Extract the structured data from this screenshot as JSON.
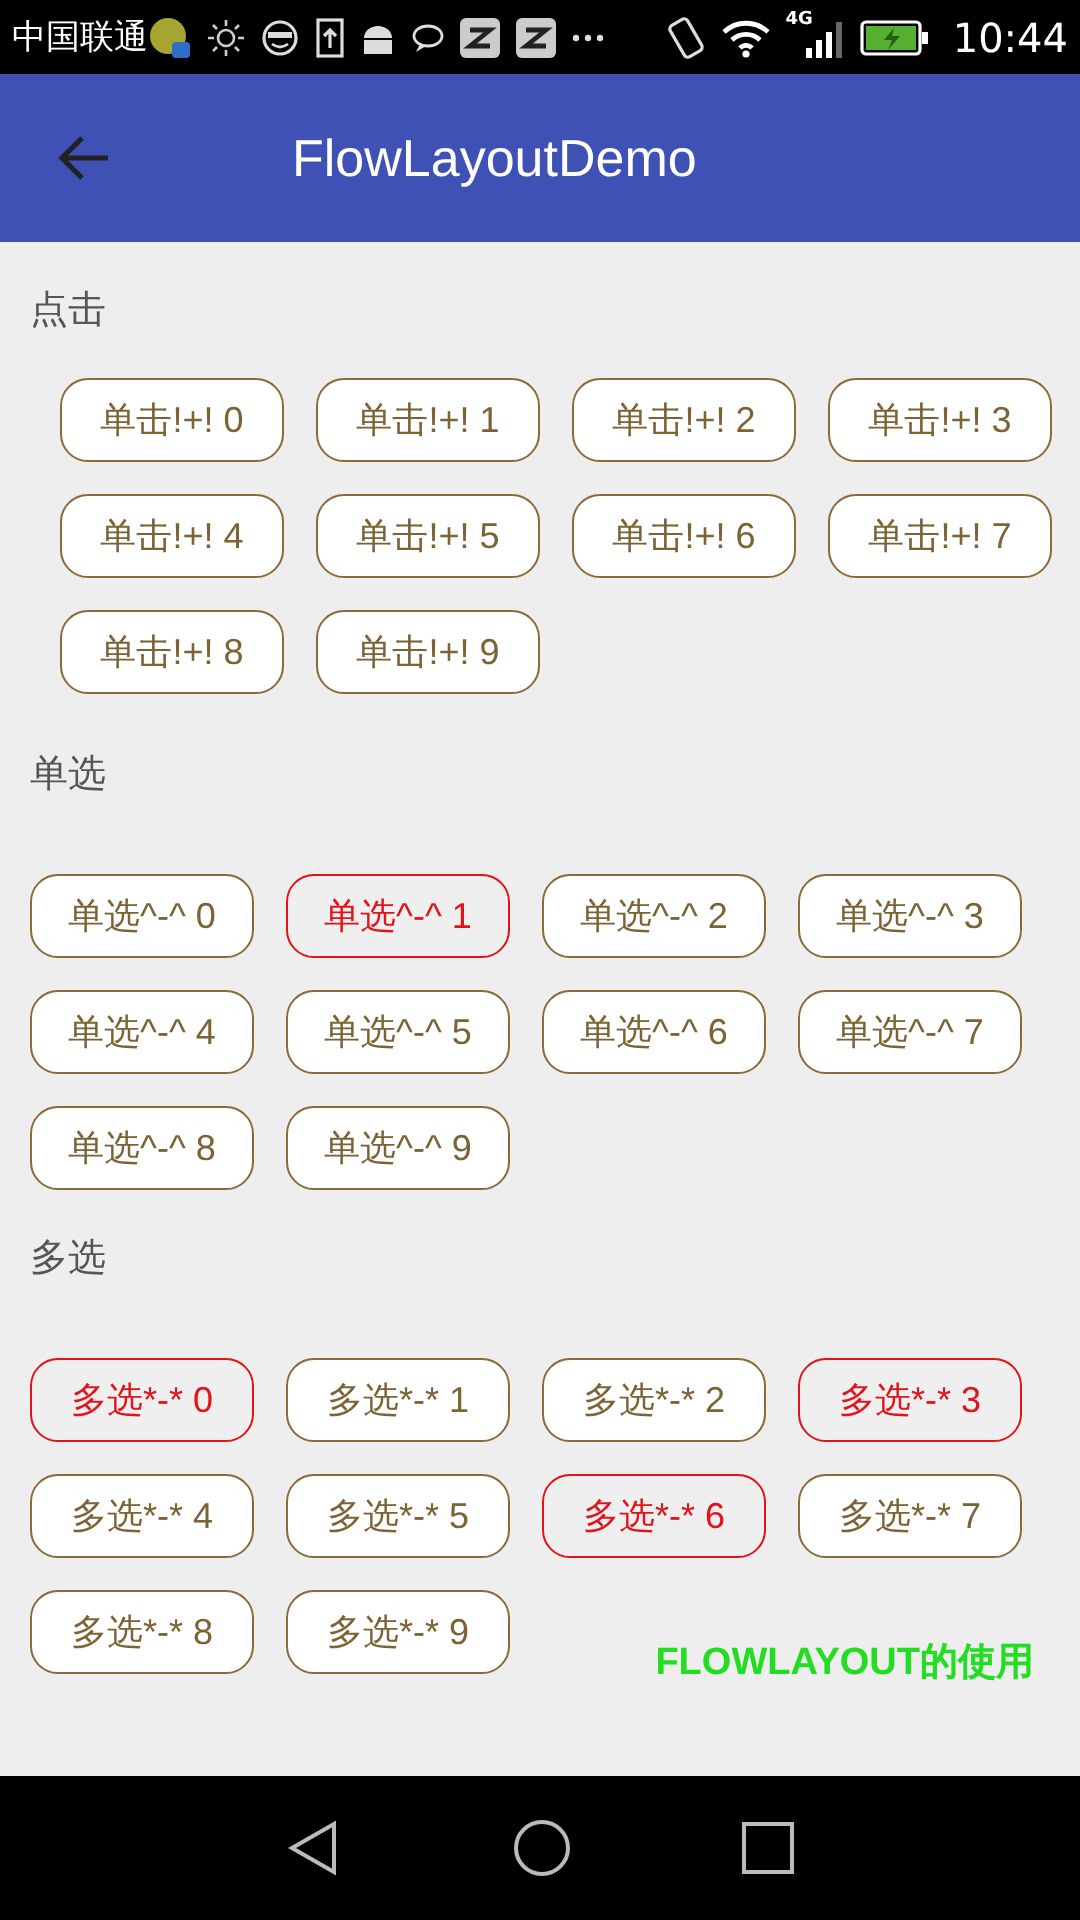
{
  "status_bar": {
    "carrier": "中国联通",
    "network": "4G",
    "time": "10:44"
  },
  "app_bar": {
    "title": "FlowLayoutDemo"
  },
  "sections": [
    {
      "kind": "click",
      "title": "点击",
      "tags": [
        {
          "label": "单击!+! 0",
          "selected": false
        },
        {
          "label": "单击!+! 1",
          "selected": false
        },
        {
          "label": "单击!+! 2",
          "selected": false
        },
        {
          "label": "单击!+! 3",
          "selected": false
        },
        {
          "label": "单击!+! 4",
          "selected": false
        },
        {
          "label": "单击!+! 5",
          "selected": false
        },
        {
          "label": "单击!+! 6",
          "selected": false
        },
        {
          "label": "单击!+! 7",
          "selected": false
        },
        {
          "label": "单击!+! 8",
          "selected": false
        },
        {
          "label": "单击!+! 9",
          "selected": false
        }
      ]
    },
    {
      "kind": "single",
      "title": "单选",
      "tags": [
        {
          "label": "单选^-^ 0",
          "selected": false
        },
        {
          "label": "单选^-^ 1",
          "selected": true
        },
        {
          "label": "单选^-^ 2",
          "selected": false
        },
        {
          "label": "单选^-^ 3",
          "selected": false
        },
        {
          "label": "单选^-^ 4",
          "selected": false
        },
        {
          "label": "单选^-^ 5",
          "selected": false
        },
        {
          "label": "单选^-^ 6",
          "selected": false
        },
        {
          "label": "单选^-^ 7",
          "selected": false
        },
        {
          "label": "单选^-^ 8",
          "selected": false
        },
        {
          "label": "单选^-^ 9",
          "selected": false
        }
      ]
    },
    {
      "kind": "multi",
      "title": "多选",
      "tags": [
        {
          "label": "多选*-* 0",
          "selected": true
        },
        {
          "label": "多选*-* 1",
          "selected": false
        },
        {
          "label": "多选*-* 2",
          "selected": false
        },
        {
          "label": "多选*-* 3",
          "selected": true
        },
        {
          "label": "多选*-* 4",
          "selected": false
        },
        {
          "label": "多选*-* 5",
          "selected": false
        },
        {
          "label": "多选*-* 6",
          "selected": true
        },
        {
          "label": "多选*-* 7",
          "selected": false
        },
        {
          "label": "多选*-* 8",
          "selected": false
        },
        {
          "label": "多选*-* 9",
          "selected": false
        }
      ]
    }
  ],
  "caption": "FLOWLAYOUT的使用"
}
